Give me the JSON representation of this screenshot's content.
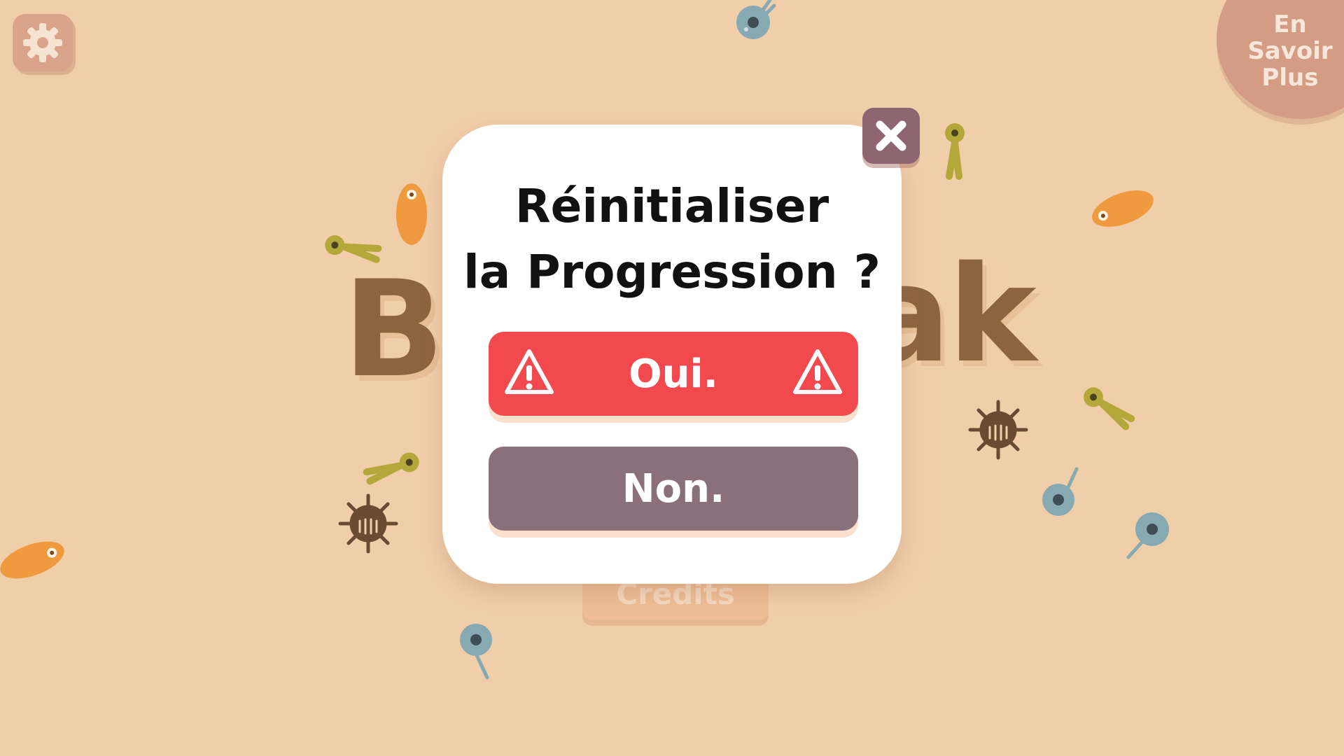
{
  "background": {
    "color": "#f1ceaa"
  },
  "game_title": {
    "left_part": "Bo",
    "right_part": "ak"
  },
  "settings": {
    "icon": "gear-icon"
  },
  "learn_more": {
    "label": "En\nSavoir\nPlus"
  },
  "credits": {
    "label": "Credits"
  },
  "dialog": {
    "title": "Réinitialiser\nla Progression ?",
    "confirm_label": "Oui.",
    "cancel_label": "Non.",
    "close_icon": "close-icon",
    "warning_icon": "warning-triangle-icon",
    "colors": {
      "confirm": "#f2494e",
      "cancel": "#8a707a",
      "close": "#8e6570"
    }
  }
}
